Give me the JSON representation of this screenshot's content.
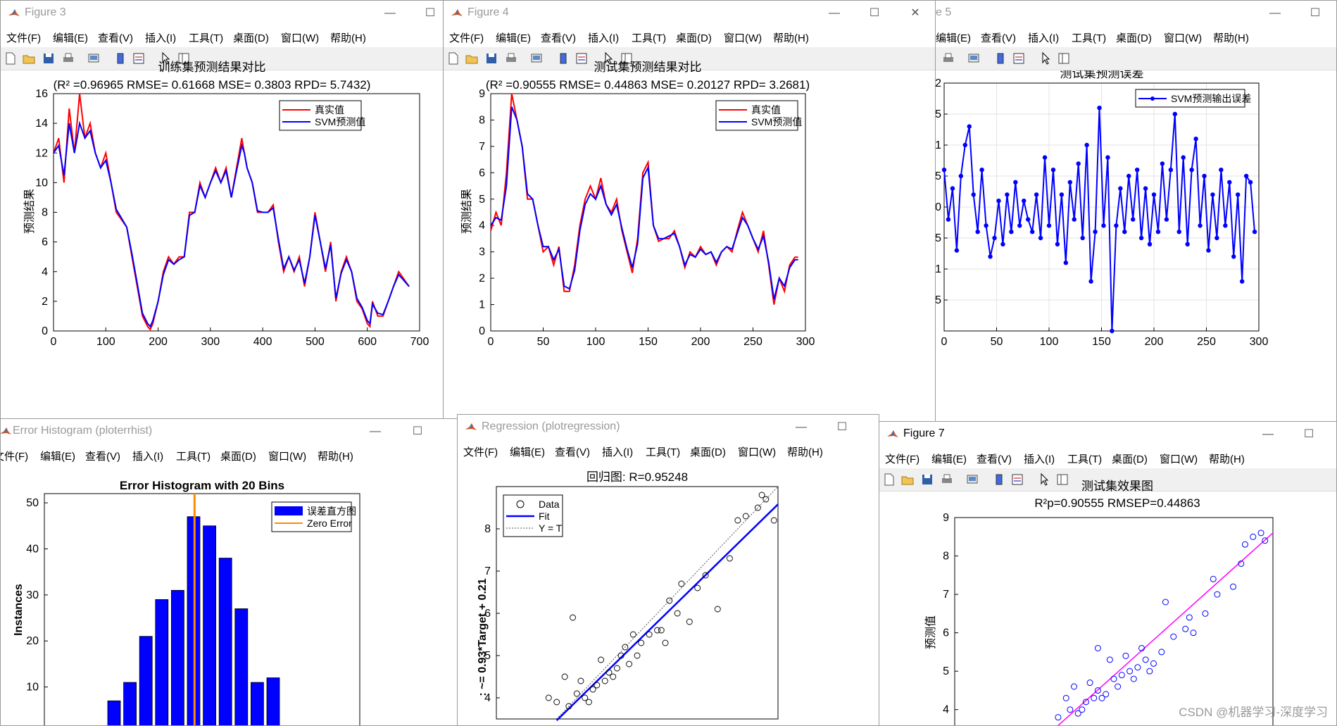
{
  "menu": [
    "文件(F)",
    "编辑(E)",
    "查看(V)",
    "插入(I)",
    "工具(T)",
    "桌面(D)",
    "窗口(W)",
    "帮助(H)"
  ],
  "windows": {
    "fig3": {
      "title": "Figure 3",
      "chart_title": "训练集预测结果对比",
      "chart_subtitle": "(R² =0.96965 RMSE= 0.61668 MSE= 0.3803 RPD= 5.7432)",
      "ylabel": "预测结果",
      "legend": [
        "真实值",
        "SVM预测值"
      ]
    },
    "fig4": {
      "title": "Figure 4",
      "chart_title": "测试集预测结果对比",
      "chart_subtitle": "(R² =0.90555 RMSE= 0.44863 MSE= 0.20127 RPD= 3.2681)",
      "ylabel": "预测结果",
      "legend": [
        "真实值",
        "SVM预测值"
      ]
    },
    "fig5": {
      "title": "e 5",
      "chart_title": "测试集预测误差",
      "legend": [
        "SVM预测输出误差"
      ]
    },
    "errhist": {
      "title": "Error Histogram (ploterrhist)",
      "chart_title": "Error Histogram with 20 Bins",
      "ylabel": "Instances",
      "legend": [
        "误差直方图",
        "Zero Error"
      ]
    },
    "regress": {
      "title": "Regression (plotregression)",
      "chart_title": "回归图: R=0.95248",
      "ylabel": ": ~= 0.93*Target + 0.21",
      "legend": [
        "Data",
        "Fit",
        "Y = T"
      ]
    },
    "fig7": {
      "title": "Figure 7",
      "chart_title": "测试集效果图",
      "chart_subtitle": "R²p=0.90555  RMSEP=0.44863",
      "ylabel": "预测值"
    }
  },
  "watermark": "CSDN @机器学习-深度学习",
  "colors": {
    "real": "#ff0000",
    "pred": "#0000ff",
    "zero": "#ff8c00",
    "fit7": "#ff00ff",
    "pts7": "#0000ff",
    "hist": "#0000ff"
  },
  "chart_data": [
    {
      "id": "fig3",
      "type": "line",
      "title": "训练集预测结果对比",
      "subtitle": "(R² =0.96965 RMSE= 0.61668 MSE= 0.3803 RPD= 5.7432)",
      "ylabel": "预测结果",
      "xlim": [
        0,
        700
      ],
      "ylim": [
        0,
        16
      ],
      "xticks": [
        0,
        100,
        200,
        300,
        400,
        500,
        600,
        700
      ],
      "yticks": [
        0,
        2,
        4,
        6,
        8,
        10,
        12,
        14,
        16
      ],
      "grid": false,
      "legend_position": "top-right",
      "series": [
        {
          "name": "真实值",
          "color": "#ff0000",
          "x": [
            0,
            10,
            20,
            30,
            40,
            50,
            60,
            70,
            80,
            90,
            100,
            110,
            120,
            130,
            140,
            150,
            160,
            170,
            180,
            185,
            190,
            200,
            210,
            220,
            230,
            240,
            250,
            260,
            270,
            280,
            290,
            300,
            310,
            320,
            330,
            340,
            350,
            360,
            365,
            370,
            380,
            390,
            400,
            410,
            420,
            430,
            440,
            450,
            460,
            470,
            480,
            490,
            500,
            510,
            520,
            530,
            540,
            550,
            560,
            570,
            580,
            590,
            600,
            605,
            610,
            620,
            630,
            640,
            650,
            660,
            670,
            680
          ],
          "y": [
            12,
            13,
            10,
            15,
            12,
            16,
            13,
            14,
            12,
            11,
            12,
            10,
            8,
            7.5,
            7,
            5,
            3,
            1,
            0.3,
            0.1,
            0.5,
            2,
            4,
            5,
            4.5,
            5,
            5,
            8,
            8,
            10,
            9,
            10,
            11,
            10,
            11,
            9,
            11,
            13,
            12,
            11,
            10,
            8,
            8,
            8,
            8.5,
            6,
            4,
            5,
            4,
            5,
            3,
            5,
            8,
            6,
            4,
            6,
            2,
            4,
            5,
            4,
            2,
            1.5,
            0.5,
            0.3,
            2,
            1,
            1,
            2,
            3,
            4,
            3.5,
            3
          ]
        },
        {
          "name": "SVM预测值",
          "color": "#0000ff",
          "x": [
            0,
            10,
            20,
            30,
            40,
            50,
            60,
            70,
            80,
            90,
            100,
            110,
            120,
            130,
            140,
            150,
            160,
            170,
            180,
            185,
            190,
            200,
            210,
            220,
            230,
            240,
            250,
            260,
            270,
            280,
            290,
            300,
            310,
            320,
            330,
            340,
            350,
            360,
            365,
            370,
            380,
            390,
            400,
            410,
            420,
            430,
            440,
            450,
            460,
            470,
            480,
            490,
            500,
            510,
            520,
            530,
            540,
            550,
            560,
            570,
            580,
            590,
            600,
            605,
            610,
            620,
            630,
            640,
            650,
            660,
            670,
            680
          ],
          "y": [
            12,
            12.5,
            10.5,
            14,
            12,
            14,
            13,
            13.5,
            12,
            11,
            11.5,
            10,
            8.2,
            7.6,
            7,
            5.2,
            3.2,
            1.2,
            0.5,
            0.3,
            0.7,
            2,
            3.8,
            4.8,
            4.5,
            4.8,
            5,
            7.8,
            8,
            9.8,
            9,
            10,
            10.8,
            10,
            10.8,
            9,
            10.8,
            12.5,
            12,
            11,
            10,
            8.1,
            8,
            8,
            8.3,
            6.2,
            4.2,
            5,
            4.1,
            4.8,
            3.2,
            5,
            7.8,
            6,
            4.2,
            5.8,
            2.2,
            3.9,
            4.8,
            4,
            2.2,
            1.6,
            0.7,
            0.5,
            1.8,
            1.2,
            1.1,
            2,
            3,
            3.8,
            3.4,
            3
          ]
        }
      ]
    },
    {
      "id": "fig4",
      "type": "line",
      "title": "测试集预测结果对比",
      "subtitle": "(R² =0.90555 RMSE= 0.44863 MSE= 0.20127 RPD= 3.2681)",
      "ylabel": "预测结果",
      "xlim": [
        0,
        300
      ],
      "ylim": [
        0,
        9
      ],
      "xticks": [
        0,
        50,
        100,
        150,
        200,
        250,
        300
      ],
      "yticks": [
        0,
        1,
        2,
        3,
        4,
        5,
        6,
        7,
        8,
        9
      ],
      "grid": false,
      "legend_position": "top-right",
      "series": [
        {
          "name": "真实值",
          "color": "#ff0000",
          "x": [
            0,
            5,
            10,
            15,
            20,
            25,
            30,
            35,
            40,
            45,
            50,
            55,
            60,
            65,
            70,
            75,
            80,
            85,
            90,
            95,
            100,
            105,
            110,
            115,
            120,
            125,
            130,
            135,
            140,
            145,
            150,
            155,
            160,
            165,
            170,
            175,
            180,
            185,
            190,
            195,
            200,
            205,
            210,
            215,
            220,
            225,
            230,
            235,
            240,
            245,
            250,
            255,
            260,
            265,
            270,
            275,
            280,
            285,
            290,
            293
          ],
          "y": [
            3.8,
            4.5,
            4,
            6,
            9,
            8,
            7,
            5,
            5,
            4,
            3,
            3.2,
            2.5,
            3.2,
            1.5,
            1.5,
            2.5,
            4,
            5,
            5.5,
            5,
            5.8,
            4.8,
            4.5,
            5,
            3.8,
            3,
            2.2,
            3.5,
            6,
            6.4,
            4,
            3.4,
            3.5,
            3.5,
            3.8,
            3.2,
            2.4,
            3,
            2.8,
            3.2,
            2.9,
            3,
            2.5,
            3,
            3.2,
            3,
            3.8,
            4.5,
            4,
            3.5,
            3,
            3.8,
            2.5,
            1,
            2,
            1.5,
            2.5,
            2.8,
            2.8
          ]
        },
        {
          "name": "SVM预测值",
          "color": "#0000ff",
          "x": [
            0,
            5,
            10,
            15,
            20,
            25,
            30,
            35,
            40,
            45,
            50,
            55,
            60,
            65,
            70,
            75,
            80,
            85,
            90,
            95,
            100,
            105,
            110,
            115,
            120,
            125,
            130,
            135,
            140,
            145,
            150,
            155,
            160,
            165,
            170,
            175,
            180,
            185,
            190,
            195,
            200,
            205,
            210,
            215,
            220,
            225,
            230,
            235,
            240,
            245,
            250,
            255,
            260,
            265,
            270,
            275,
            280,
            285,
            290,
            293
          ],
          "y": [
            4,
            4.3,
            4.2,
            5.5,
            8.5,
            8,
            7,
            5.2,
            5,
            4,
            3.2,
            3.2,
            2.7,
            3.1,
            1.7,
            1.6,
            2.3,
            3.8,
            4.8,
            5.2,
            5,
            5.5,
            4.8,
            4.4,
            4.8,
            3.9,
            3.1,
            2.4,
            3.3,
            5.8,
            6.2,
            4,
            3.5,
            3.5,
            3.6,
            3.7,
            3.2,
            2.5,
            2.9,
            2.8,
            3.1,
            2.9,
            3,
            2.6,
            3,
            3.2,
            3.1,
            3.7,
            4.3,
            4,
            3.5,
            3.1,
            3.6,
            2.6,
            1.2,
            2,
            1.7,
            2.4,
            2.7,
            2.7
          ]
        }
      ]
    },
    {
      "id": "fig5",
      "type": "line",
      "title": "测试集预测误差",
      "xlim": [
        0,
        300
      ],
      "ylim": [
        -2,
        2
      ],
      "xticks": [
        0,
        50,
        100,
        150,
        200,
        250,
        300
      ],
      "yticks_printed": [
        "5",
        "1",
        "5",
        "0",
        "5",
        "1",
        "5",
        "2"
      ],
      "grid": true,
      "legend_position": "top-right",
      "series": [
        {
          "name": "SVM预测输出误差",
          "color": "#0000ff",
          "marker": "*",
          "x": [
            0,
            4,
            8,
            12,
            16,
            20,
            24,
            28,
            32,
            36,
            40,
            44,
            48,
            52,
            56,
            60,
            64,
            68,
            72,
            76,
            80,
            84,
            88,
            92,
            96,
            100,
            104,
            108,
            112,
            116,
            120,
            124,
            128,
            132,
            136,
            140,
            144,
            148,
            152,
            156,
            160,
            164,
            168,
            172,
            176,
            180,
            184,
            188,
            192,
            196,
            200,
            204,
            208,
            212,
            216,
            220,
            224,
            228,
            232,
            236,
            240,
            244,
            248,
            252,
            256,
            260,
            264,
            268,
            272,
            276,
            280,
            284,
            288,
            292,
            296
          ],
          "y": [
            0.6,
            -0.2,
            0.3,
            -0.7,
            0.5,
            1.0,
            1.3,
            0.2,
            -0.4,
            0.6,
            -0.3,
            -0.8,
            -0.5,
            0.1,
            -0.6,
            0.2,
            -0.4,
            0.4,
            -0.3,
            0.1,
            -0.2,
            -0.4,
            0.2,
            -0.5,
            0.8,
            -0.3,
            0.6,
            -0.6,
            0.2,
            -0.9,
            0.4,
            -0.2,
            0.7,
            -0.5,
            1.0,
            -1.2,
            -0.4,
            1.6,
            -0.3,
            0.8,
            -2.0,
            -0.3,
            0.3,
            -0.4,
            0.5,
            -0.2,
            0.6,
            -0.5,
            0.3,
            -0.6,
            0.2,
            -0.4,
            0.7,
            -0.2,
            0.6,
            1.5,
            -0.4,
            0.8,
            -0.6,
            0.6,
            1.1,
            -0.3,
            0.5,
            -0.7,
            0.2,
            -0.5,
            0.6,
            -0.3,
            0.4,
            -0.8,
            0.2,
            -1.2,
            0.5,
            0.4,
            -0.4
          ]
        }
      ]
    },
    {
      "id": "errhist",
      "type": "bar",
      "title": "Error Histogram with 20 Bins",
      "ylabel": "Instances",
      "ylim": [
        0,
        52
      ],
      "yticks": [
        10,
        20,
        30,
        40,
        50
      ],
      "grid": false,
      "legend_position": "top-right",
      "series": [
        {
          "name": "误差直方图",
          "color": "#0000ff",
          "values": [
            7,
            11,
            21,
            29,
            31,
            47,
            45,
            38,
            27,
            11,
            12
          ]
        }
      ],
      "zero_error": {
        "name": "Zero Error",
        "color": "#ff8c00",
        "bin_position": 5.5
      }
    },
    {
      "id": "regress",
      "type": "scatter",
      "title": "回归图: R=0.95248",
      "ylabel": ": ~= 0.93*Target + 0.21",
      "xlim": [
        2,
        9
      ],
      "ylim": [
        3.5,
        9
      ],
      "yticks": [
        4,
        5,
        6,
        7,
        8
      ],
      "grid": false,
      "legend_position": "top-left",
      "fit": {
        "name": "Fit",
        "slope": 0.93,
        "intercept": 0.21,
        "color": "#0000ff"
      },
      "identity": {
        "name": "Y = T"
      },
      "series": [
        {
          "name": "Data",
          "x": [
            3.5,
            3.8,
            4.0,
            4.2,
            4.5,
            4.8,
            5.0,
            5.2,
            5.5,
            5.8,
            6.0,
            6.2,
            6.5,
            6.8,
            7.0,
            7.2,
            7.5,
            8.0,
            8.2,
            8.5,
            8.7,
            8.9,
            4.1,
            4.4,
            4.6,
            3.9,
            5.3,
            5.6,
            6.3,
            4.9,
            4.3,
            5.1,
            6.6,
            3.7,
            3.3,
            7.8,
            8.6,
            4.7,
            5.4,
            6.1
          ],
          "y": [
            3.9,
            3.8,
            4.1,
            4.0,
            4.3,
            4.6,
            4.7,
            5.2,
            5.0,
            5.5,
            5.6,
            5.3,
            6.0,
            5.8,
            6.6,
            6.9,
            6.1,
            8.2,
            8.3,
            8.5,
            8.7,
            8.2,
            4.4,
            4.2,
            4.9,
            5.9,
            4.8,
            5.3,
            6.3,
            4.5,
            3.9,
            5.0,
            6.7,
            4.5,
            4.0,
            7.3,
            8.8,
            4.4,
            5.5,
            5.6
          ]
        }
      ]
    },
    {
      "id": "fig7",
      "type": "scatter",
      "title": "测试集效果图",
      "subtitle": "R²p=0.90555  RMSEP=0.44863",
      "ylabel": "预测值",
      "xlim": [
        1,
        9
      ],
      "ylim": [
        3.5,
        9
      ],
      "yticks": [
        4,
        5,
        6,
        7,
        8,
        9
      ],
      "grid": false,
      "fit_color": "#ff00ff",
      "series": [
        {
          "name": "",
          "color": "#0000ff",
          "x": [
            3.6,
            3.9,
            4.1,
            4.3,
            4.5,
            4.6,
            4.8,
            5.0,
            5.2,
            5.4,
            5.6,
            5.8,
            6.0,
            6.2,
            6.5,
            6.8,
            7.0,
            7.3,
            7.6,
            8.0,
            8.3,
            8.5,
            8.7,
            8.8,
            4.0,
            4.2,
            4.4,
            4.7,
            4.9,
            5.1,
            5.3,
            5.5,
            5.7,
            3.8,
            4.6,
            5.9,
            6.3,
            6.9,
            7.5,
            8.2
          ],
          "y": [
            3.8,
            4.0,
            3.9,
            4.2,
            4.3,
            4.5,
            4.4,
            4.8,
            4.9,
            5.0,
            5.1,
            5.3,
            5.2,
            5.5,
            5.9,
            6.1,
            6.0,
            6.5,
            7.0,
            7.2,
            8.3,
            8.5,
            8.6,
            8.4,
            4.6,
            4.0,
            4.7,
            4.3,
            5.3,
            4.6,
            5.4,
            4.8,
            5.6,
            4.3,
            5.6,
            5.0,
            6.8,
            6.4,
            7.4,
            7.8
          ]
        }
      ]
    }
  ]
}
